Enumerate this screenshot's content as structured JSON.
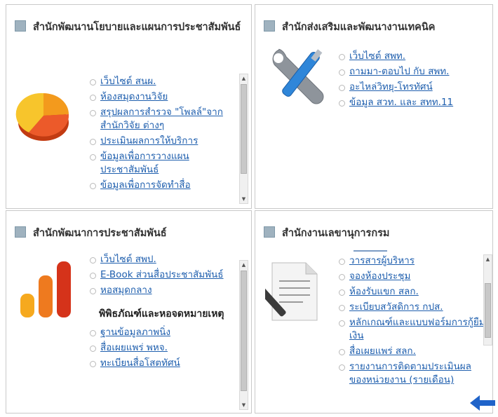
{
  "panels": {
    "top_left": {
      "title": "สำนักพัฒนานโยบายและแผนการประชาสัมพันธ์",
      "icon": "pie-chart-icon",
      "links": [
        "เว็บไซต์ สนผ.",
        "ห้องสมุดงานวิจัย",
        "สรุปผลการสำรวจ \"โพลล์\"จากสำนักวิจัย ต่างๆ",
        "ประเมินผลการให้บริการ",
        "ข้อมูลเพื่อการวางแผนประชาสัมพันธ์",
        "ข้อมูลเพื่อการจัดทำสื่อ"
      ]
    },
    "top_right": {
      "title": "สำนักส่งเสริมและพัฒนางานเทคนิค",
      "icon": "tools-icon",
      "links": [
        "เว็บไซต์ สพท.",
        "ถามมา-ตอบไป กับ สพท.",
        "อะไหล่วิทยุ-โทรทัศน์",
        "ข้อมูล สวท. และ สทท.11"
      ]
    },
    "bottom_left": {
      "title": "สำนักพัฒนาการประชาสัมพันธ์",
      "icon": "bar-chart-icon",
      "links": [
        "เว็บไซต์ สพป.",
        "E-Book ส่วนสื่อประชาสัมพันธ์",
        "หอสมุดกลาง"
      ],
      "subheading": "พิพิธภัณฑ์และหอจดหมายเหตุ",
      "sublinks": [
        "ฐานข้อมูลภาพนิ่ง",
        "สื่อเผยแพร่ พหจ.",
        "ทะเบียนสื่อโสตทัศน์"
      ]
    },
    "bottom_right": {
      "title": "สำนักงานเลขานุการกรม",
      "icon": "document-pen-icon",
      "links": [
        "วารสารผู้บริหาร",
        "จองห้องประชุม",
        "ห้องรับแขก สลก.",
        "ระเบียบสวัสดิการ กปส.",
        "หลักเกณฑ์และแบบฟอร์มการกู้ยืมเงิน",
        "สื่อเผยแพร่ สลก.",
        "รายงานการติดตามประเมินผลของหน่วยงาน (รายเดือน)"
      ]
    }
  },
  "colors": {
    "link": "#1f5fae",
    "arrow": "#1f63c9",
    "title_text": "#333333"
  },
  "annotation_icon": "left-arrow-icon"
}
